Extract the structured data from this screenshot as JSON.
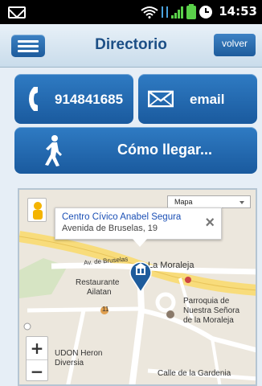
{
  "status_bar": {
    "time": "14:53"
  },
  "header": {
    "title": "Directorio",
    "back_label": "volver"
  },
  "actions": {
    "phone": "914841685",
    "email": "email",
    "route": "Cómo llegar..."
  },
  "map": {
    "map_type": "Mapa",
    "info": {
      "title": "Centro Cívico Anabel Segura",
      "address": "Avenida de Bruselas, 19"
    },
    "zoom_in": "+",
    "zoom_out": "−",
    "labels": {
      "street1": "Av. de Bruselas",
      "place1": "La Moraleja",
      "place2a": "Restaurante",
      "place2b": "Ailatan",
      "place3a": "Parroquia de",
      "place3b": "Nuestra Señora",
      "place3c": "de la Moraleja",
      "place4a": "UDON Heron",
      "place4b": "Diversia",
      "street2": "Calle de la Gardenia",
      "road_num": "11"
    }
  },
  "colors": {
    "primary": "#1e5c9c",
    "title": "#1c4f86",
    "accent_green": "#5ad14a"
  }
}
